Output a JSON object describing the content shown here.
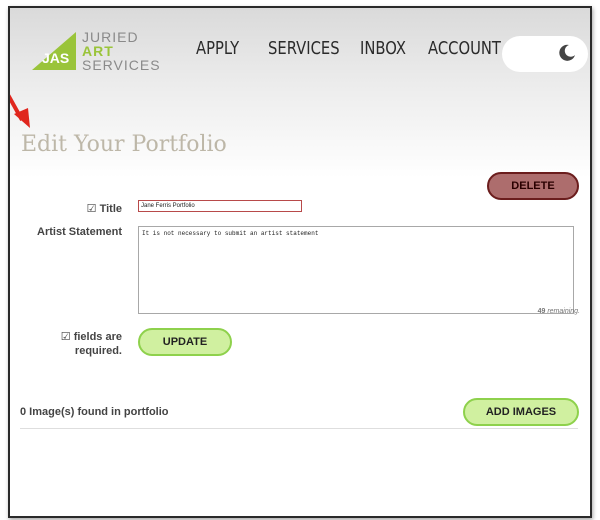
{
  "logo": {
    "line1": "JURIED",
    "line2": "ART",
    "line3": "SERVICES",
    "mark": "JAS"
  },
  "nav": [
    {
      "label": "APPLY"
    },
    {
      "label": "SERVICES"
    },
    {
      "label": "INBOX"
    },
    {
      "label": "ACCOUNT"
    }
  ],
  "theme_toggle": {
    "icon": "moon-icon"
  },
  "page": {
    "title": "Edit Your Portfolio"
  },
  "buttons": {
    "delete": "DELETE",
    "update": "UPDATE",
    "add_images": "ADD IMAGES"
  },
  "form": {
    "title_label": "Title",
    "title_value": "Jane Ferris Portfolio",
    "statement_label": "Artist Statement",
    "statement_value": "It is not necessary to submit an artist statement",
    "remaining_count": "49",
    "remaining_text": "remaining.",
    "required_line1": "fields are",
    "required_line2": "required.",
    "checkbox_glyph": "☑"
  },
  "portfolio": {
    "count_text": "0 Image(s) found in portfolio"
  },
  "colors": {
    "accent_green": "#9ac43a",
    "delete_red": "#ad6d6d",
    "button_green": "#d0f0a0",
    "arrow_red": "#e0261d"
  }
}
